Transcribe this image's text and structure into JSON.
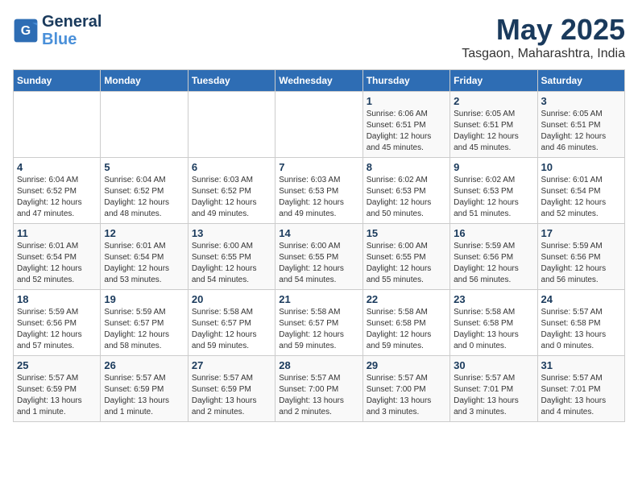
{
  "logo": {
    "line1": "General",
    "line2": "Blue"
  },
  "title": "May 2025",
  "subtitle": "Tasgaon, Maharashtra, India",
  "days_of_week": [
    "Sunday",
    "Monday",
    "Tuesday",
    "Wednesday",
    "Thursday",
    "Friday",
    "Saturday"
  ],
  "weeks": [
    [
      {
        "num": "",
        "info": ""
      },
      {
        "num": "",
        "info": ""
      },
      {
        "num": "",
        "info": ""
      },
      {
        "num": "",
        "info": ""
      },
      {
        "num": "1",
        "info": "Sunrise: 6:06 AM\nSunset: 6:51 PM\nDaylight: 12 hours\nand 45 minutes."
      },
      {
        "num": "2",
        "info": "Sunrise: 6:05 AM\nSunset: 6:51 PM\nDaylight: 12 hours\nand 45 minutes."
      },
      {
        "num": "3",
        "info": "Sunrise: 6:05 AM\nSunset: 6:51 PM\nDaylight: 12 hours\nand 46 minutes."
      }
    ],
    [
      {
        "num": "4",
        "info": "Sunrise: 6:04 AM\nSunset: 6:52 PM\nDaylight: 12 hours\nand 47 minutes."
      },
      {
        "num": "5",
        "info": "Sunrise: 6:04 AM\nSunset: 6:52 PM\nDaylight: 12 hours\nand 48 minutes."
      },
      {
        "num": "6",
        "info": "Sunrise: 6:03 AM\nSunset: 6:52 PM\nDaylight: 12 hours\nand 49 minutes."
      },
      {
        "num": "7",
        "info": "Sunrise: 6:03 AM\nSunset: 6:53 PM\nDaylight: 12 hours\nand 49 minutes."
      },
      {
        "num": "8",
        "info": "Sunrise: 6:02 AM\nSunset: 6:53 PM\nDaylight: 12 hours\nand 50 minutes."
      },
      {
        "num": "9",
        "info": "Sunrise: 6:02 AM\nSunset: 6:53 PM\nDaylight: 12 hours\nand 51 minutes."
      },
      {
        "num": "10",
        "info": "Sunrise: 6:01 AM\nSunset: 6:54 PM\nDaylight: 12 hours\nand 52 minutes."
      }
    ],
    [
      {
        "num": "11",
        "info": "Sunrise: 6:01 AM\nSunset: 6:54 PM\nDaylight: 12 hours\nand 52 minutes."
      },
      {
        "num": "12",
        "info": "Sunrise: 6:01 AM\nSunset: 6:54 PM\nDaylight: 12 hours\nand 53 minutes."
      },
      {
        "num": "13",
        "info": "Sunrise: 6:00 AM\nSunset: 6:55 PM\nDaylight: 12 hours\nand 54 minutes."
      },
      {
        "num": "14",
        "info": "Sunrise: 6:00 AM\nSunset: 6:55 PM\nDaylight: 12 hours\nand 54 minutes."
      },
      {
        "num": "15",
        "info": "Sunrise: 6:00 AM\nSunset: 6:55 PM\nDaylight: 12 hours\nand 55 minutes."
      },
      {
        "num": "16",
        "info": "Sunrise: 5:59 AM\nSunset: 6:56 PM\nDaylight: 12 hours\nand 56 minutes."
      },
      {
        "num": "17",
        "info": "Sunrise: 5:59 AM\nSunset: 6:56 PM\nDaylight: 12 hours\nand 56 minutes."
      }
    ],
    [
      {
        "num": "18",
        "info": "Sunrise: 5:59 AM\nSunset: 6:56 PM\nDaylight: 12 hours\nand 57 minutes."
      },
      {
        "num": "19",
        "info": "Sunrise: 5:59 AM\nSunset: 6:57 PM\nDaylight: 12 hours\nand 58 minutes."
      },
      {
        "num": "20",
        "info": "Sunrise: 5:58 AM\nSunset: 6:57 PM\nDaylight: 12 hours\nand 59 minutes."
      },
      {
        "num": "21",
        "info": "Sunrise: 5:58 AM\nSunset: 6:57 PM\nDaylight: 12 hours\nand 59 minutes."
      },
      {
        "num": "22",
        "info": "Sunrise: 5:58 AM\nSunset: 6:58 PM\nDaylight: 12 hours\nand 59 minutes."
      },
      {
        "num": "23",
        "info": "Sunrise: 5:58 AM\nSunset: 6:58 PM\nDaylight: 13 hours\nand 0 minutes."
      },
      {
        "num": "24",
        "info": "Sunrise: 5:57 AM\nSunset: 6:58 PM\nDaylight: 13 hours\nand 0 minutes."
      }
    ],
    [
      {
        "num": "25",
        "info": "Sunrise: 5:57 AM\nSunset: 6:59 PM\nDaylight: 13 hours\nand 1 minute."
      },
      {
        "num": "26",
        "info": "Sunrise: 5:57 AM\nSunset: 6:59 PM\nDaylight: 13 hours\nand 1 minute."
      },
      {
        "num": "27",
        "info": "Sunrise: 5:57 AM\nSunset: 6:59 PM\nDaylight: 13 hours\nand 2 minutes."
      },
      {
        "num": "28",
        "info": "Sunrise: 5:57 AM\nSunset: 7:00 PM\nDaylight: 13 hours\nand 2 minutes."
      },
      {
        "num": "29",
        "info": "Sunrise: 5:57 AM\nSunset: 7:00 PM\nDaylight: 13 hours\nand 3 minutes."
      },
      {
        "num": "30",
        "info": "Sunrise: 5:57 AM\nSunset: 7:01 PM\nDaylight: 13 hours\nand 3 minutes."
      },
      {
        "num": "31",
        "info": "Sunrise: 5:57 AM\nSunset: 7:01 PM\nDaylight: 13 hours\nand 4 minutes."
      }
    ]
  ]
}
